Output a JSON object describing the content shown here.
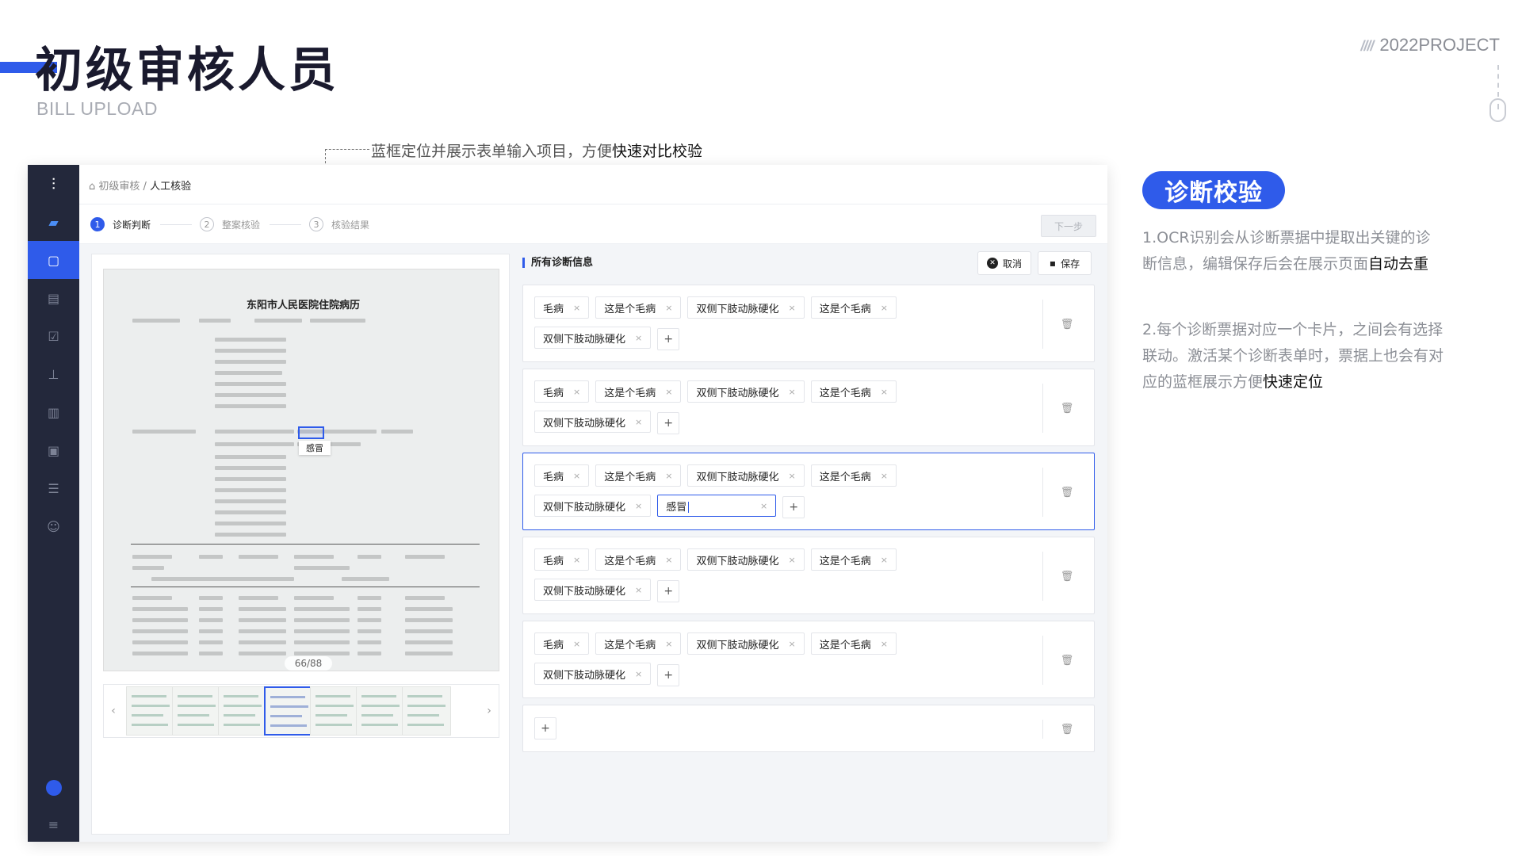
{
  "header": {
    "title": "初级审核人员",
    "subtitle": "BILL UPLOAD",
    "project_slashes": "////",
    "project_label": "2022PROJECT"
  },
  "callout": {
    "text": "蓝框定位并展示表单输入项目，方便",
    "highlight": "快速对比校验"
  },
  "app": {
    "sidebar_icons": [
      "waveform-logo-icon",
      "chat-icon",
      "document-check-icon",
      "archive-icon",
      "clipboard-icon",
      "stamp-icon",
      "file-list-icon",
      "toolbox-icon",
      "list-settings-icon",
      "user-settings-icon"
    ],
    "breadcrumb": {
      "parent": "初级审核",
      "separator": "/",
      "current": "人工核验"
    },
    "steps": [
      {
        "num": "1",
        "label": "诊断判断",
        "active": true
      },
      {
        "num": "2",
        "label": "整案核验",
        "active": false
      },
      {
        "num": "3",
        "label": "核验结果",
        "active": false
      }
    ],
    "next_button": "下一步",
    "bill": {
      "doc_title": "东阳市人民医院住院病历",
      "box_label": "感冒",
      "page_indicator": "66/88",
      "prev_arrow": "‹",
      "next_arrow": "›"
    },
    "diagnosis": {
      "panel_title": "所有诊断信息",
      "cancel_label": "取消",
      "save_label": "保存",
      "cards": [
        {
          "tags": [
            "毛病",
            "这是个毛病",
            "双侧下肢动脉硬化",
            "这是个毛病",
            "双侧下肢动脉硬化"
          ],
          "editing": null,
          "active": false
        },
        {
          "tags": [
            "毛病",
            "这是个毛病",
            "双侧下肢动脉硬化",
            "这是个毛病",
            "双侧下肢动脉硬化"
          ],
          "editing": null,
          "active": false
        },
        {
          "tags": [
            "毛病",
            "这是个毛病",
            "双侧下肢动脉硬化",
            "这是个毛病",
            "双侧下肢动脉硬化"
          ],
          "editing": "感冒",
          "active": true
        },
        {
          "tags": [
            "毛病",
            "这是个毛病",
            "双侧下肢动脉硬化",
            "这是个毛病",
            "双侧下肢动脉硬化"
          ],
          "editing": null,
          "active": false
        },
        {
          "tags": [
            "毛病",
            "这是个毛病",
            "双侧下肢动脉硬化",
            "这是个毛病",
            "双侧下肢动脉硬化"
          ],
          "editing": null,
          "active": false
        },
        {
          "tags": [],
          "editing": null,
          "active": false
        }
      ],
      "add_symbol": "+",
      "remove_symbol": "×"
    }
  },
  "right": {
    "badge": "诊断校验",
    "desc1": "1.OCR识别会从诊断票据中提取出关键的诊断信息，编辑保存后会在展示页面",
    "desc1_hl": "自动去重",
    "desc2": "2.每个诊断票据对应一个卡片，之间会有选择联动。激活某个诊断表单时，票据上也会有对应的蓝框展示方便",
    "desc2_hl": "快速定位"
  },
  "colors": {
    "accent": "#2f5bea",
    "sidebar": "#23283b"
  }
}
